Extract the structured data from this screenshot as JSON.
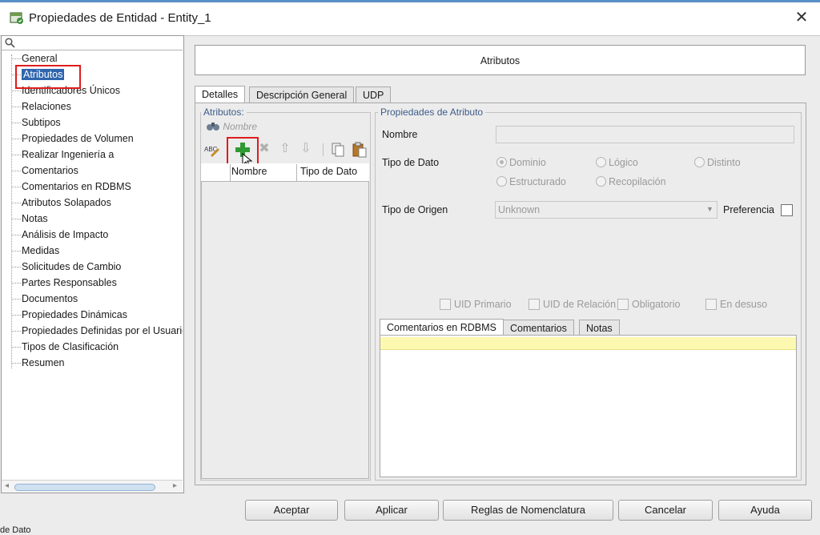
{
  "window": {
    "title": "Propiedades de Entidad - Entity_1",
    "close": "✕"
  },
  "tree": {
    "items": [
      {
        "label": "General"
      },
      {
        "label": "Atributos",
        "selected": true
      },
      {
        "label": "Identificadores Únicos"
      },
      {
        "label": "Relaciones"
      },
      {
        "label": "Subtipos"
      },
      {
        "label": "Propiedades de Volumen"
      },
      {
        "label": "Realizar Ingeniería a"
      },
      {
        "label": "Comentarios"
      },
      {
        "label": "Comentarios en RDBMS"
      },
      {
        "label": "Atributos Solapados"
      },
      {
        "label": "Notas"
      },
      {
        "label": "Análisis de Impacto"
      },
      {
        "label": "Medidas"
      },
      {
        "label": "Solicitudes de Cambio"
      },
      {
        "label": "Partes Responsables"
      },
      {
        "label": "Documentos"
      },
      {
        "label": "Propiedades Dinámicas"
      },
      {
        "label": "Propiedades Definidas por el Usuario"
      },
      {
        "label": "Tipos de Clasificación"
      },
      {
        "label": "Resumen"
      }
    ]
  },
  "header": {
    "title": "Atributos"
  },
  "tabs": [
    {
      "label": "Detalles",
      "active": true
    },
    {
      "label": "Descripción General"
    },
    {
      "label": "UDP"
    }
  ],
  "attributes_panel": {
    "title": "Atributos:",
    "filter_placeholder": "Nombre",
    "columns": [
      "Nombre",
      "Tipo de Dato"
    ]
  },
  "properties_panel": {
    "title": "Propiedades de Atributo",
    "name_label": "Nombre",
    "name_value": "",
    "data_type_label": "Tipo de Dato",
    "data_type_options": [
      {
        "label": "Dominio",
        "selected": true
      },
      {
        "label": "Lógico"
      },
      {
        "label": "Distinto"
      },
      {
        "label": "Estructurado"
      },
      {
        "label": "Recopilación"
      }
    ],
    "origin_label": "Tipo de Origen",
    "origin_value": "Unknown",
    "preference_label": "Preferencia",
    "checks": [
      "UID Primario",
      "UID de Relación",
      "Obligatorio",
      "En desuso"
    ],
    "sub_tabs": [
      {
        "label": "Comentarios en RDBMS",
        "active": true
      },
      {
        "label": "Comentarios"
      },
      {
        "label": "Notas"
      }
    ]
  },
  "buttons": {
    "accept": "Aceptar",
    "apply": "Aplicar",
    "naming": "Reglas de Nomenclatura",
    "cancel": "Cancelar",
    "help": "Ayuda"
  },
  "status_fragment": "de Dato",
  "colors": {
    "selection": "#2f65ad",
    "highlight_box": "#e01c1c",
    "group_title": "#3c5c8a",
    "comment_row": "#fdf8b0"
  }
}
